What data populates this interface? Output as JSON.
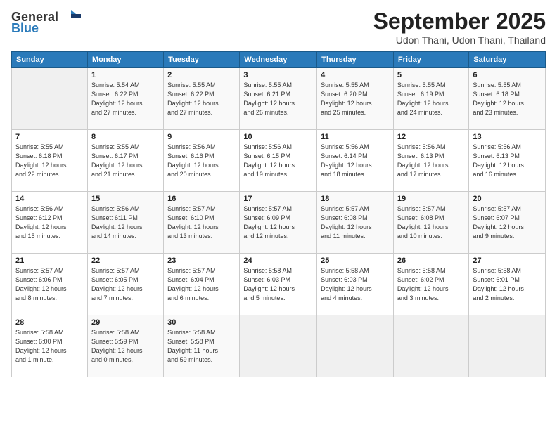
{
  "logo": {
    "general": "General",
    "blue": "Blue"
  },
  "title": "September 2025",
  "subtitle": "Udon Thani, Udon Thani, Thailand",
  "header_days": [
    "Sunday",
    "Monday",
    "Tuesday",
    "Wednesday",
    "Thursday",
    "Friday",
    "Saturday"
  ],
  "weeks": [
    [
      {
        "day": "",
        "info": ""
      },
      {
        "day": "1",
        "info": "Sunrise: 5:54 AM\nSunset: 6:22 PM\nDaylight: 12 hours\nand 27 minutes."
      },
      {
        "day": "2",
        "info": "Sunrise: 5:55 AM\nSunset: 6:22 PM\nDaylight: 12 hours\nand 27 minutes."
      },
      {
        "day": "3",
        "info": "Sunrise: 5:55 AM\nSunset: 6:21 PM\nDaylight: 12 hours\nand 26 minutes."
      },
      {
        "day": "4",
        "info": "Sunrise: 5:55 AM\nSunset: 6:20 PM\nDaylight: 12 hours\nand 25 minutes."
      },
      {
        "day": "5",
        "info": "Sunrise: 5:55 AM\nSunset: 6:19 PM\nDaylight: 12 hours\nand 24 minutes."
      },
      {
        "day": "6",
        "info": "Sunrise: 5:55 AM\nSunset: 6:18 PM\nDaylight: 12 hours\nand 23 minutes."
      }
    ],
    [
      {
        "day": "7",
        "info": "Sunrise: 5:55 AM\nSunset: 6:18 PM\nDaylight: 12 hours\nand 22 minutes."
      },
      {
        "day": "8",
        "info": "Sunrise: 5:55 AM\nSunset: 6:17 PM\nDaylight: 12 hours\nand 21 minutes."
      },
      {
        "day": "9",
        "info": "Sunrise: 5:56 AM\nSunset: 6:16 PM\nDaylight: 12 hours\nand 20 minutes."
      },
      {
        "day": "10",
        "info": "Sunrise: 5:56 AM\nSunset: 6:15 PM\nDaylight: 12 hours\nand 19 minutes."
      },
      {
        "day": "11",
        "info": "Sunrise: 5:56 AM\nSunset: 6:14 PM\nDaylight: 12 hours\nand 18 minutes."
      },
      {
        "day": "12",
        "info": "Sunrise: 5:56 AM\nSunset: 6:13 PM\nDaylight: 12 hours\nand 17 minutes."
      },
      {
        "day": "13",
        "info": "Sunrise: 5:56 AM\nSunset: 6:13 PM\nDaylight: 12 hours\nand 16 minutes."
      }
    ],
    [
      {
        "day": "14",
        "info": "Sunrise: 5:56 AM\nSunset: 6:12 PM\nDaylight: 12 hours\nand 15 minutes."
      },
      {
        "day": "15",
        "info": "Sunrise: 5:56 AM\nSunset: 6:11 PM\nDaylight: 12 hours\nand 14 minutes."
      },
      {
        "day": "16",
        "info": "Sunrise: 5:57 AM\nSunset: 6:10 PM\nDaylight: 12 hours\nand 13 minutes."
      },
      {
        "day": "17",
        "info": "Sunrise: 5:57 AM\nSunset: 6:09 PM\nDaylight: 12 hours\nand 12 minutes."
      },
      {
        "day": "18",
        "info": "Sunrise: 5:57 AM\nSunset: 6:08 PM\nDaylight: 12 hours\nand 11 minutes."
      },
      {
        "day": "19",
        "info": "Sunrise: 5:57 AM\nSunset: 6:08 PM\nDaylight: 12 hours\nand 10 minutes."
      },
      {
        "day": "20",
        "info": "Sunrise: 5:57 AM\nSunset: 6:07 PM\nDaylight: 12 hours\nand 9 minutes."
      }
    ],
    [
      {
        "day": "21",
        "info": "Sunrise: 5:57 AM\nSunset: 6:06 PM\nDaylight: 12 hours\nand 8 minutes."
      },
      {
        "day": "22",
        "info": "Sunrise: 5:57 AM\nSunset: 6:05 PM\nDaylight: 12 hours\nand 7 minutes."
      },
      {
        "day": "23",
        "info": "Sunrise: 5:57 AM\nSunset: 6:04 PM\nDaylight: 12 hours\nand 6 minutes."
      },
      {
        "day": "24",
        "info": "Sunrise: 5:58 AM\nSunset: 6:03 PM\nDaylight: 12 hours\nand 5 minutes."
      },
      {
        "day": "25",
        "info": "Sunrise: 5:58 AM\nSunset: 6:03 PM\nDaylight: 12 hours\nand 4 minutes."
      },
      {
        "day": "26",
        "info": "Sunrise: 5:58 AM\nSunset: 6:02 PM\nDaylight: 12 hours\nand 3 minutes."
      },
      {
        "day": "27",
        "info": "Sunrise: 5:58 AM\nSunset: 6:01 PM\nDaylight: 12 hours\nand 2 minutes."
      }
    ],
    [
      {
        "day": "28",
        "info": "Sunrise: 5:58 AM\nSunset: 6:00 PM\nDaylight: 12 hours\nand 1 minute."
      },
      {
        "day": "29",
        "info": "Sunrise: 5:58 AM\nSunset: 5:59 PM\nDaylight: 12 hours\nand 0 minutes."
      },
      {
        "day": "30",
        "info": "Sunrise: 5:58 AM\nSunset: 5:58 PM\nDaylight: 11 hours\nand 59 minutes."
      },
      {
        "day": "",
        "info": ""
      },
      {
        "day": "",
        "info": ""
      },
      {
        "day": "",
        "info": ""
      },
      {
        "day": "",
        "info": ""
      }
    ]
  ]
}
